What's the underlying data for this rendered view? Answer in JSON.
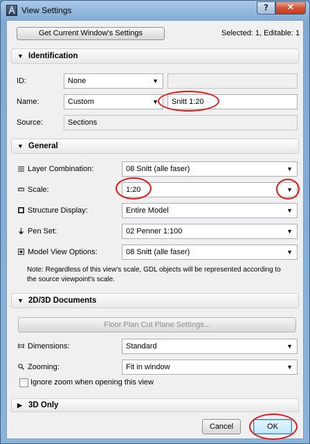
{
  "window": {
    "title": "View Settings",
    "help_glyph": "?",
    "close_glyph": "×"
  },
  "top": {
    "get_settings_label": "Get Current Window's Settings",
    "status": "Selected: 1, Editable: 1"
  },
  "identification": {
    "header": "Identification",
    "id_label": "ID:",
    "id_value": "None",
    "id_text": "",
    "name_label": "Name:",
    "name_value": "Custom",
    "name_text": "Snitt 1:20",
    "source_label": "Source:",
    "source_value": "Sections"
  },
  "general": {
    "header": "General",
    "layer_label": "Layer Combination:",
    "layer_value": "08 Snitt (alle faser)",
    "scale_label": "Scale:",
    "scale_value": "1:20",
    "structure_label": "Structure Display:",
    "structure_value": "Entire Model",
    "penset_label": "Pen Set:",
    "penset_value": "02 Penner 1:100",
    "mvo_label": "Model View Options:",
    "mvo_value": "08 Snitt (alle faser)",
    "note_line1": "Note: Regardless of this view's scale, GDL objects will be represented according to",
    "note_line2": "the source viewpoint's scale."
  },
  "documents": {
    "header": "2D/3D Documents",
    "cut_plane_label": "Floor Plan Cut Plane Settings...",
    "dimensions_label": "Dimensions:",
    "dimensions_value": "Standard",
    "zooming_label": "Zooming:",
    "zooming_value": "Fit in window",
    "ignore_zoom_label": "Ignore zoom when opening this view",
    "ignore_zoom_checked": false
  },
  "only3d": {
    "header": "3D Only"
  },
  "buttons": {
    "cancel": "Cancel",
    "ok": "OK"
  },
  "glyphs": {
    "expanded": "▼",
    "collapsed": "▶",
    "dropdown": "▼"
  },
  "colors": {
    "highlight_ring": "#e01a1a",
    "ok_border": "#3c7fb1"
  }
}
